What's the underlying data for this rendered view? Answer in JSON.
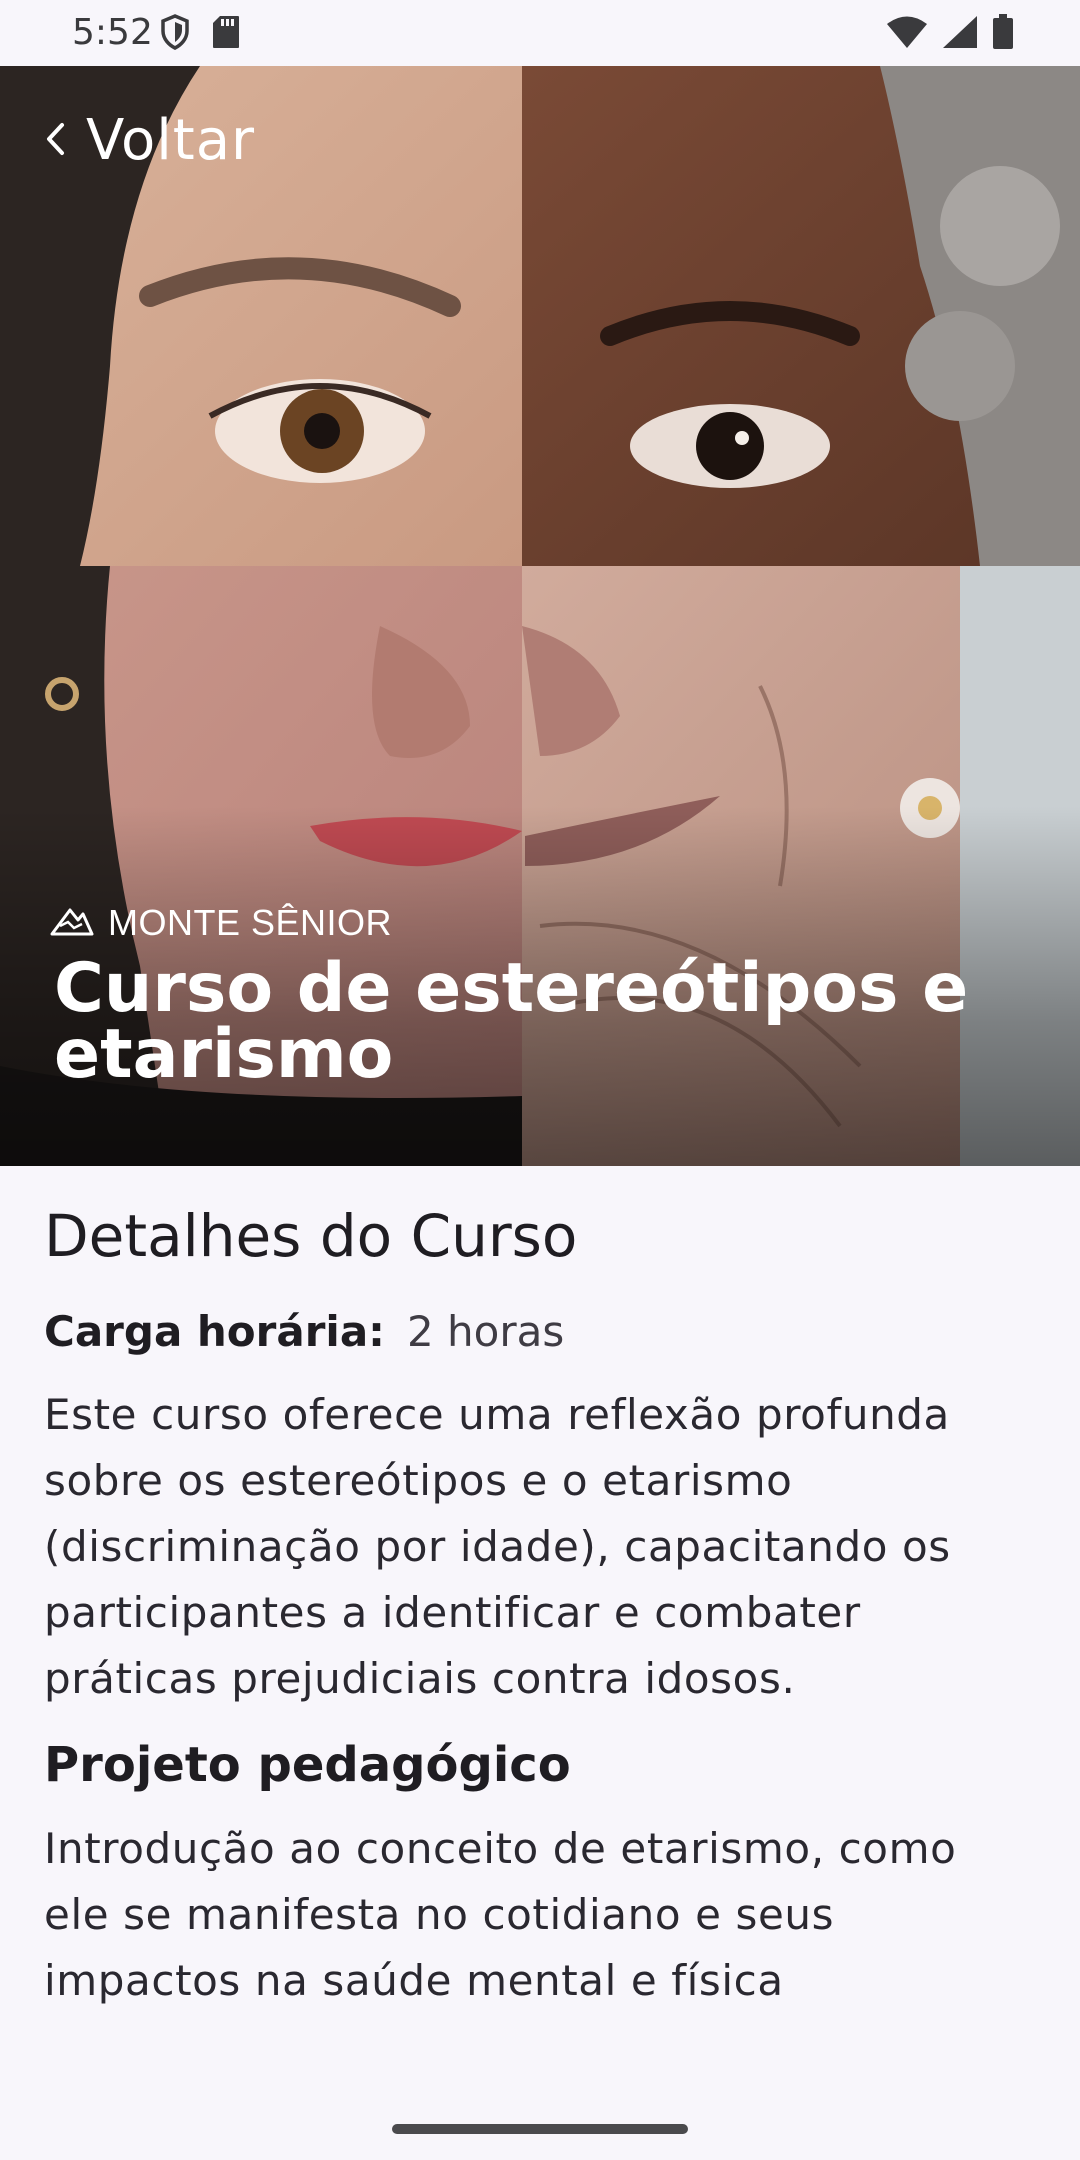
{
  "status_bar": {
    "time": "5:52",
    "left_icons": [
      "shield-icon",
      "sd-card-icon"
    ],
    "right_icons": [
      "wifi-icon",
      "signal-icon",
      "battery-icon"
    ]
  },
  "hero": {
    "back_label": "Voltar",
    "brand": "MONTE SÊNIOR",
    "title": "Curso de estereótipos e etarismo"
  },
  "details": {
    "heading": "Detalhes do Curso",
    "workload_label": "Carga horária:",
    "workload_value": "2 horas",
    "description": "Este curso oferece uma reflexão profunda sobre os estereótipos e o etarismo (discriminação por idade), capacitando os participantes a identificar e combater práticas prejudiciais contra idosos.",
    "pedagogical_heading": "Projeto pedagógico",
    "pedagogical_text": "Introdução ao conceito de etarismo, como ele se manifesta no cotidiano e seus impactos na saúde mental e física"
  },
  "colors": {
    "background": "#f8f6fb",
    "text": "#1f1d22",
    "hero_text": "#ffffff"
  }
}
